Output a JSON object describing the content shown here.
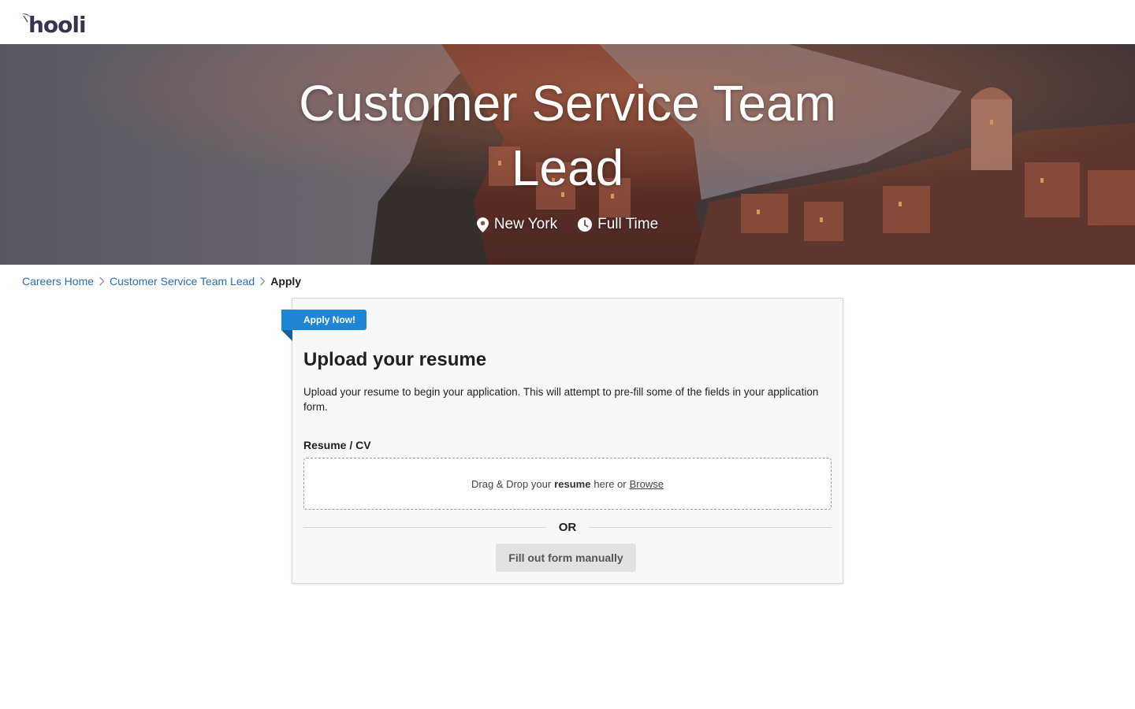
{
  "header": {
    "logo_text": "hooli"
  },
  "hero": {
    "title_line1": "Customer Service Team",
    "title_line2": "Lead",
    "location": "New York",
    "employment_type": "Full Time"
  },
  "breadcrumb": {
    "items": [
      {
        "label": "Careers Home"
      },
      {
        "label": "Customer Service Team Lead"
      },
      {
        "label": "Apply"
      }
    ]
  },
  "card": {
    "ribbon": "Apply Now!",
    "title": "Upload your resume",
    "description": "Upload your resume to begin your application. This will attempt to pre-fill some of the fields in your application form.",
    "field_label": "Resume / CV",
    "dropzone": {
      "prefix": "Drag & Drop your",
      "bold": "resume",
      "middle": "here or",
      "link": "Browse"
    },
    "or_text": "OR",
    "manual_button": "Fill out form manually"
  },
  "colors": {
    "accent_blue": "#1f86d6",
    "link_blue": "#2a6db5",
    "logo": "#3a3350"
  },
  "icons": {
    "location": "map-pin-icon",
    "time": "clock-icon",
    "breadcrumb_separator": "chevron-right-icon"
  }
}
